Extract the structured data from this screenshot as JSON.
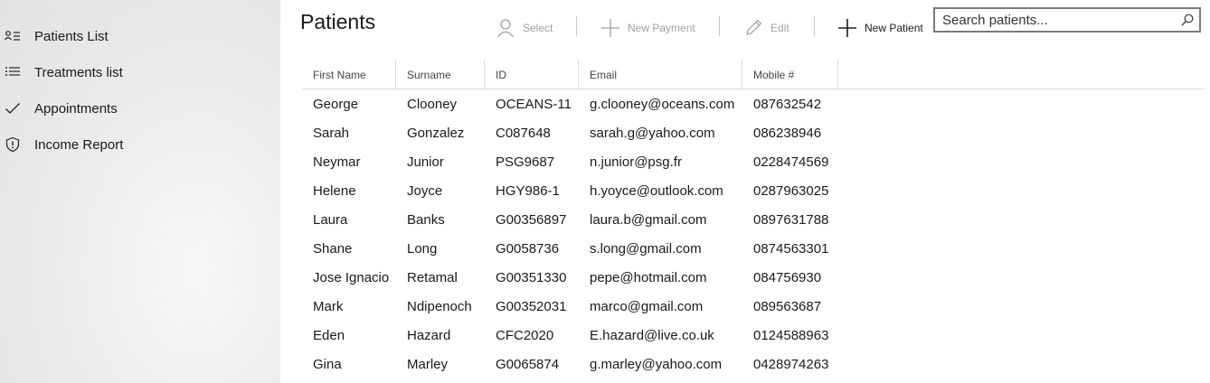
{
  "sidebar": {
    "items": [
      {
        "label": "Patients List",
        "icon": "contact-list-icon"
      },
      {
        "label": "Treatments list",
        "icon": "list-icon"
      },
      {
        "label": "Appointments",
        "icon": "checkmark-icon"
      },
      {
        "label": "Income Report",
        "icon": "shield-icon"
      }
    ]
  },
  "page": {
    "title": "Patients"
  },
  "toolbar": {
    "select_label": "Select",
    "new_payment_label": "New Payment",
    "edit_label": "Edit",
    "new_patient_label": "New Patient"
  },
  "search": {
    "placeholder": "Search patients...",
    "value": ""
  },
  "table": {
    "columns": [
      "First Name",
      "Surname",
      "ID",
      "Email",
      "Mobile #"
    ],
    "rows": [
      [
        "George",
        "Clooney",
        "OCEANS-11",
        "g.clooney@oceans.com",
        "087632542"
      ],
      [
        "Sarah",
        "Gonzalez",
        "C087648",
        "sarah.g@yahoo.com",
        "086238946"
      ],
      [
        "Neymar",
        "Junior",
        "PSG9687",
        "n.junior@psg.fr",
        "0228474569"
      ],
      [
        "Helene",
        "Joyce",
        "HGY986-1",
        "h.yoyce@outlook.com",
        "0287963025"
      ],
      [
        "Laura",
        "Banks",
        "G00356897",
        "laura.b@gmail.com",
        "0897631788"
      ],
      [
        "Shane",
        "Long",
        "G0058736",
        "s.long@gmail.com",
        "0874563301"
      ],
      [
        "Jose Ignacio",
        "Retamal",
        "G00351330",
        "pepe@hotmail.com",
        "084756930"
      ],
      [
        "Mark",
        "Ndipenoch",
        "G00352031",
        "marco@gmail.com",
        "089563687"
      ],
      [
        "Eden",
        "Hazard",
        "CFC2020",
        "E.hazard@live.co.uk",
        "0124588963"
      ],
      [
        "Gina",
        "Marley",
        "G0065874",
        "g.marley@yahoo.com",
        "0428974263"
      ]
    ]
  },
  "colors": {
    "sidebar_bg": "#e9e9e9",
    "disabled_text": "#a0a0a0",
    "text": "#1a1a1a"
  }
}
